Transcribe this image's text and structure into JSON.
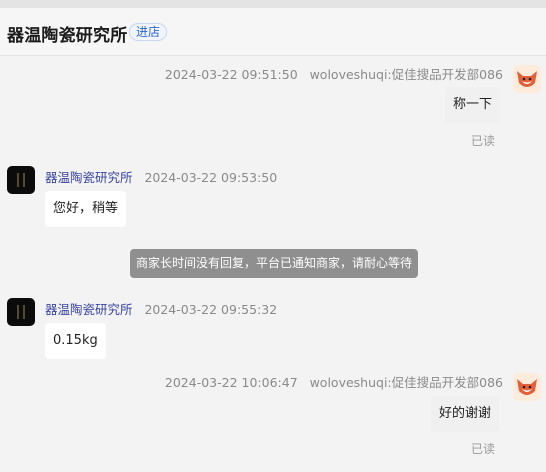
{
  "header": {
    "shop_name": "器温陶瓷研究所",
    "enter_store": "进店"
  },
  "messages": [
    {
      "timestamp": "2024-03-22 09:51:50",
      "sender": "woloveshuqi:促佳搜品开发部086",
      "text": "称一下",
      "read_status": "已读"
    },
    {
      "timestamp": "2024-03-22 09:53:50",
      "sender": "器温陶瓷研究所",
      "text": "您好，稍等"
    },
    {
      "system_notice": "商家长时间没有回复，平台已通知商家，请耐心等待"
    },
    {
      "timestamp": "2024-03-22 09:55:32",
      "sender": "器温陶瓷研究所",
      "text": "0.15kg"
    },
    {
      "timestamp": "2024-03-22 10:06:47",
      "sender": "woloveshuqi:促佳搜品开发部086",
      "text": "好的谢谢",
      "read_status": "已读"
    }
  ],
  "colors": {
    "accent_link": "#2f67c8",
    "seller_name": "#3a45a0",
    "system_toast_bg": "#8f8f8f",
    "background": "#f3f3f3"
  }
}
